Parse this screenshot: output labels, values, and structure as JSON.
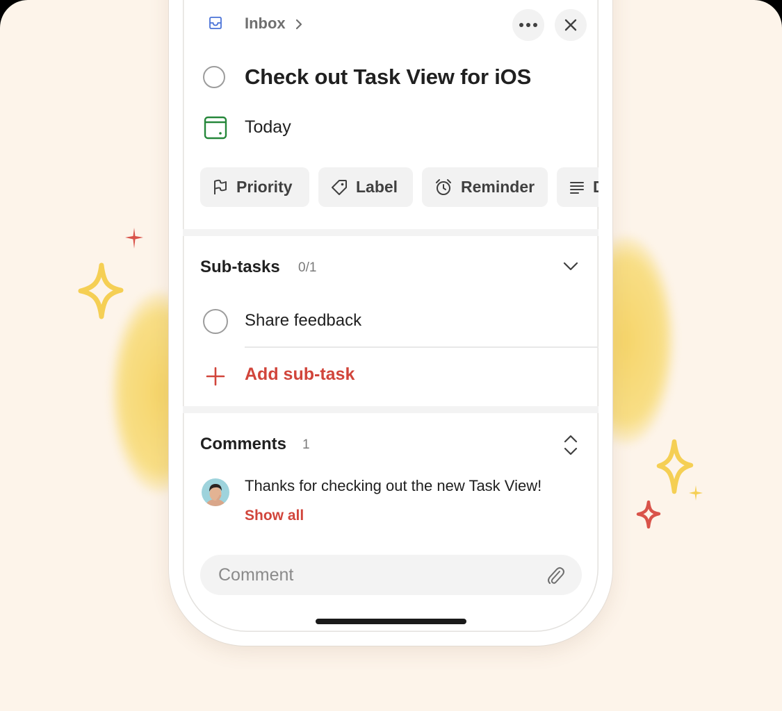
{
  "breadcrumb": {
    "project_label": "Inbox",
    "project_icon": "inbox-icon",
    "chevron_icon": "chevron-right-icon"
  },
  "header_actions": {
    "more_icon": "more-horizontal-icon",
    "close_icon": "close-icon"
  },
  "task": {
    "title": "Check out Task View for iOS",
    "completed": false,
    "due_date": "Today",
    "due_icon": "calendar-icon"
  },
  "chips": [
    {
      "label": "Priority",
      "icon": "flag-icon"
    },
    {
      "label": "Label",
      "icon": "tag-icon"
    },
    {
      "label": "Reminder",
      "icon": "alarm-clock-icon"
    },
    {
      "label": "D",
      "icon": "description-icon"
    }
  ],
  "subtasks": {
    "title": "Sub-tasks",
    "count": "0/1",
    "items": [
      {
        "label": "Share feedback",
        "completed": false
      }
    ],
    "add_label": "Add sub-task"
  },
  "comments": {
    "title": "Comments",
    "count": "1",
    "latest": {
      "text": "Thanks for checking out the new Task View!",
      "avatar": "user-avatar"
    },
    "show_all_label": "Show all",
    "input_placeholder": "Comment",
    "attach_icon": "paperclip-icon"
  },
  "colors": {
    "background": "#fdf4ea",
    "accent_red": "#d1453b",
    "today_green": "#25873a",
    "inbox_blue": "#4a73d8",
    "sparkle_yellow": "#f5cf54",
    "sparkle_red": "#d9534a"
  }
}
